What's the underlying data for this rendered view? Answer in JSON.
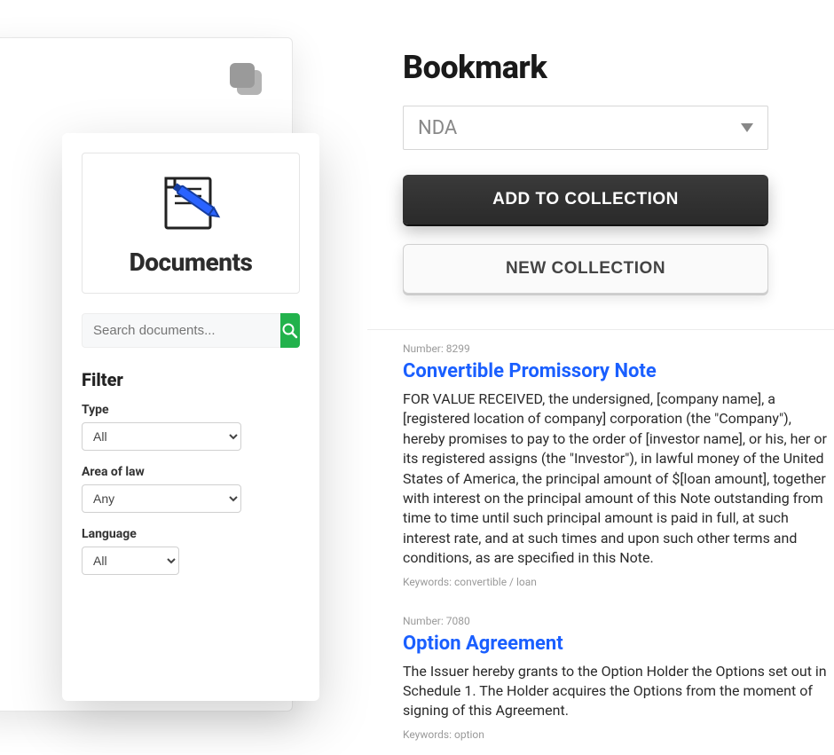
{
  "sidebar": {
    "panel_title": "Documents",
    "search_placeholder": "Search documents...",
    "filter_heading": "Filter",
    "fields": {
      "type_label": "Type",
      "type_value": "All",
      "area_label": "Area of law",
      "area_value": "Any",
      "language_label": "Language",
      "language_value": "All"
    }
  },
  "bookmark": {
    "heading": "Bookmark",
    "selected_collection": "NDA",
    "add_button": "ADD TO COLLECTION",
    "new_button": "NEW COLLECTION"
  },
  "results": [
    {
      "number_label": "Number: 8299",
      "title": "Convertible Promissory Note",
      "body": "FOR VALUE RECEIVED, the undersigned, [company name], a [registered location of company] corporation (the \"Company\"), hereby promises to pay to the order of [investor name], or his, her or its registered assigns (the \"Investor\"), in lawful money of the United States of America, the principal amount of $[loan amount], together with interest on the principal amount of this Note outstanding from time to time until such principal amount is paid in full, at such interest rate, and at such times and upon such other terms and conditions, as are specified in this Note.",
      "keywords": "Keywords: convertible / loan"
    },
    {
      "number_label": "Number: 7080",
      "title": "Option Agreement",
      "body": "The Issuer hereby grants to the Option Holder the Options set out in Schedule 1. The Holder acquires the Options from the moment of signing of this Agreement.",
      "keywords": "Keywords: option"
    }
  ]
}
